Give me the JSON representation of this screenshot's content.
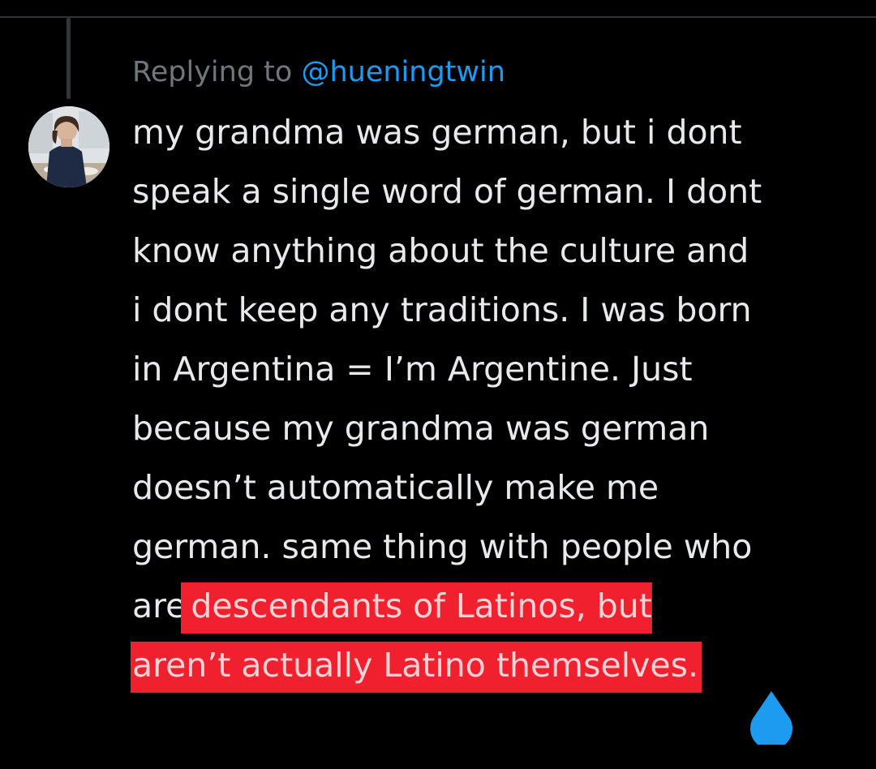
{
  "reply": {
    "prefix": "Replying to",
    "handle": "@hueningtwin"
  },
  "tweet": {
    "lines": [
      "my grandma was german, but i dont",
      "speak a single word of german. I dont",
      "know anything about the culture and",
      "i dont keep any traditions. I was born",
      "in Argentina = I’m Argentine. Just",
      "because my grandma was german",
      "doesn’t automatically make me",
      "german. same thing with people who"
    ],
    "line9_plain": "are",
    "line9_highlight": "descendants of Latinos, but",
    "line10_highlight": "aren’t actually Latino themselves."
  },
  "colors": {
    "background": "#000000",
    "text": "#e7e9ea",
    "muted": "#71767b",
    "link": "#1d9bf0",
    "highlight": "#f0202f",
    "selection_handle": "#1d9bf0"
  },
  "icons": {
    "avatar": "user-avatar",
    "selection_handle": "text-selection-handle-icon"
  }
}
